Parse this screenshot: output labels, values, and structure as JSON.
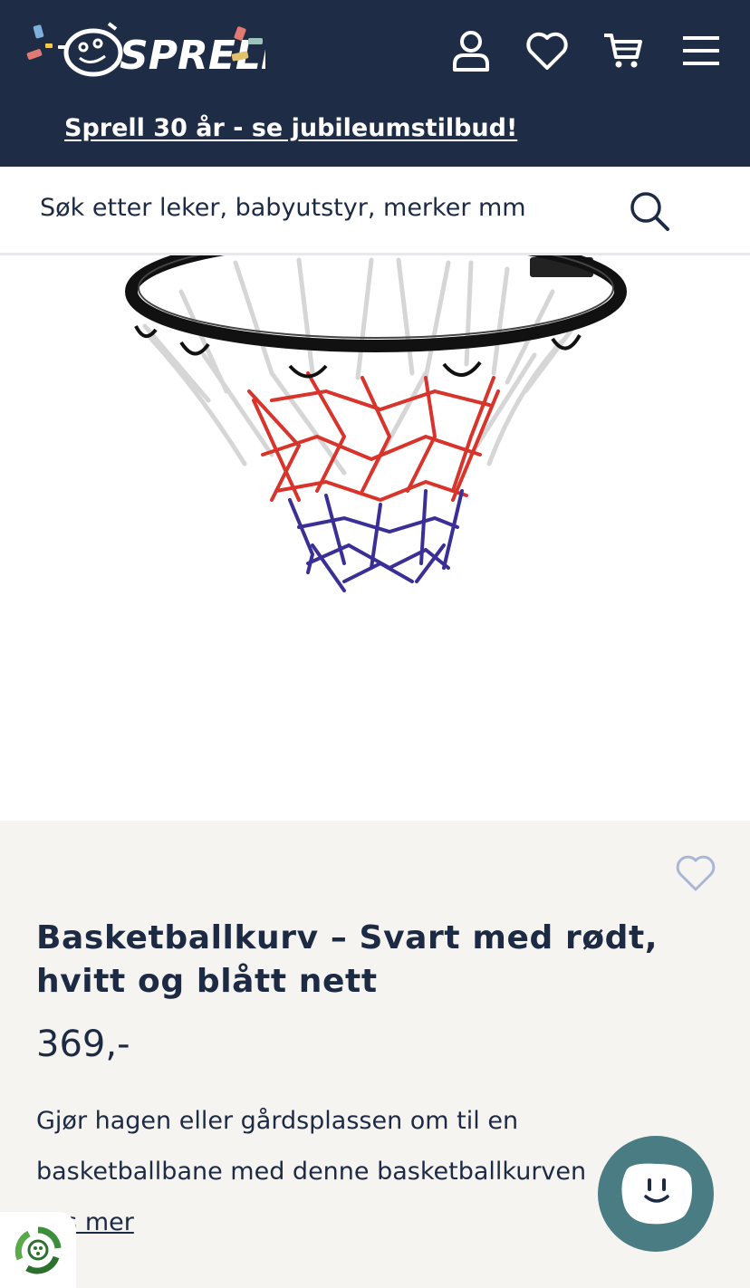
{
  "header": {
    "brand": "SPRELL",
    "banner_link": "Sprell 30 år - se jubileumstilbud!",
    "icons": [
      "user-icon",
      "heart-icon",
      "cart-icon",
      "menu-icon"
    ]
  },
  "search": {
    "placeholder": "Søk etter leker, babyutstyr, merker mm",
    "icon": "search-icon"
  },
  "product": {
    "title": "Basketballkurv – Svart med rødt, hvitt og blått nett",
    "price": "369,-",
    "description": "Gjør hagen eller gårdsplassen om til en basketballbane med denne basketballkurven",
    "read_more": "Les mer",
    "image_alt_colors": {
      "rim": "#111111",
      "net_white": "#d8d8d8",
      "net_red": "#d8342b",
      "net_blue": "#3a2f96"
    }
  },
  "widgets": {
    "eco_badge_icon": "recycle-icon",
    "chat_icon": "smiley-chat-icon"
  },
  "colors": {
    "header_bg": "#1e2d45",
    "info_bg": "#f6f4f1",
    "text": "#1d2a44",
    "chat_bg": "#4a7c84"
  }
}
